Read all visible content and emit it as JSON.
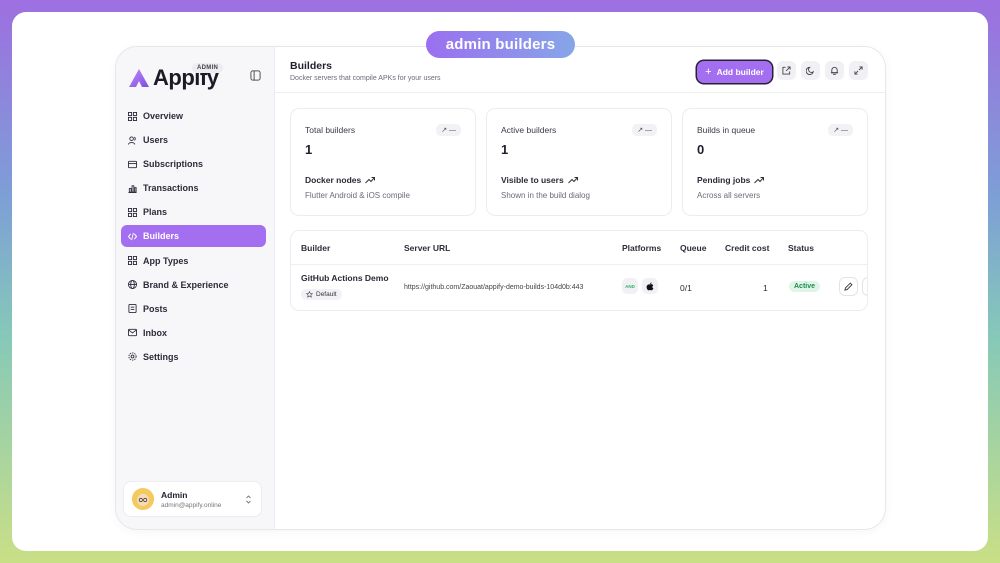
{
  "banner": {
    "title": "admin builders"
  },
  "sidebar": {
    "logo": "Appify",
    "badge": "ADMIN",
    "items": [
      {
        "label": "Overview",
        "icon": "grid-icon"
      },
      {
        "label": "Users",
        "icon": "users-icon"
      },
      {
        "label": "Subscriptions",
        "icon": "card-icon"
      },
      {
        "label": "Transactions",
        "icon": "bar-chart-icon"
      },
      {
        "label": "Plans",
        "icon": "grid-icon"
      },
      {
        "label": "Builders",
        "icon": "code-icon",
        "active": true
      },
      {
        "label": "App Types",
        "icon": "grid-icon"
      },
      {
        "label": "Brand & Experience",
        "icon": "globe-icon"
      },
      {
        "label": "Posts",
        "icon": "document-icon"
      },
      {
        "label": "Inbox",
        "icon": "mail-icon"
      },
      {
        "label": "Settings",
        "icon": "gear-icon"
      }
    ],
    "user": {
      "name": "Admin",
      "email": "admin@appify.online"
    }
  },
  "header": {
    "title": "Builders",
    "subtitle": "Docker servers that compile APKs for your users",
    "add_label": "Add builder"
  },
  "stats": [
    {
      "label": "Total builders",
      "trend": "—",
      "value": "1",
      "sub": "Docker nodes",
      "desc": "Flutter Android & iOS compile"
    },
    {
      "label": "Active builders",
      "trend": "—",
      "value": "1",
      "sub": "Visible to users",
      "desc": "Shown in the build dialog"
    },
    {
      "label": "Builds in queue",
      "trend": "—",
      "value": "0",
      "sub": "Pending jobs",
      "desc": "Across all servers"
    }
  ],
  "table": {
    "columns": [
      "Builder",
      "Server URL",
      "Platforms",
      "Queue",
      "Credit cost",
      "Status"
    ],
    "rows": [
      {
        "builder": "GitHub Actions Demo",
        "badge": "Default",
        "url": "https://github.com/Zaouat/appify-demo-builds-104d0b:443",
        "android_label": "AND",
        "queue": "0/1",
        "credit": "1",
        "status": "Active"
      }
    ]
  },
  "colors": {
    "accent": "#a46ef0",
    "active_status": "#1e8a4f"
  }
}
